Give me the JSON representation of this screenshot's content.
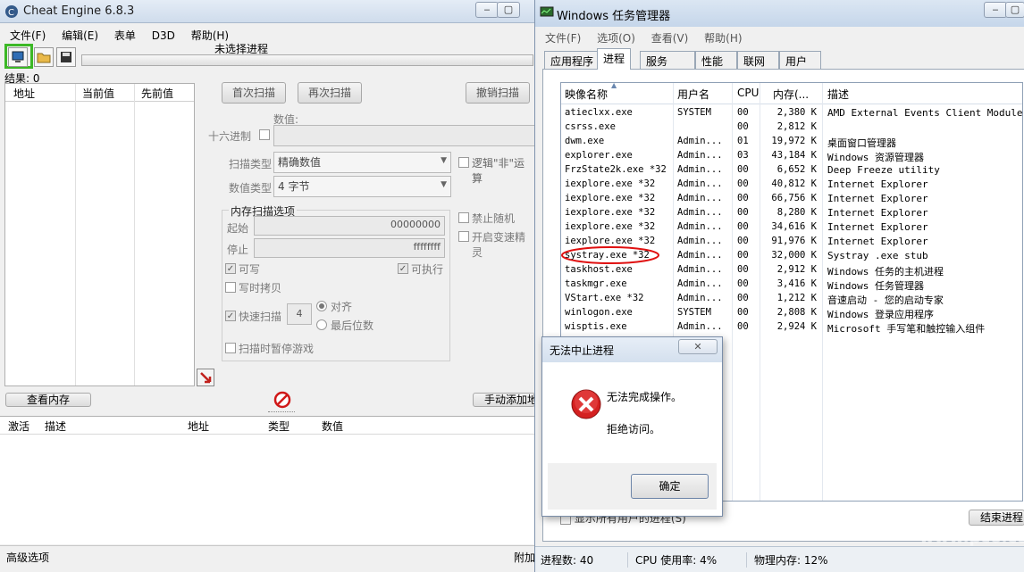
{
  "cheat_engine": {
    "title": "Cheat Engine 6.8.3",
    "window_buttons": {
      "minimize": "▭",
      "maximize": "□"
    },
    "menu": [
      "文件(F)",
      "编辑(E)",
      "表单",
      "D3D",
      "帮助(H)"
    ],
    "process_label": "未选择进程",
    "results_label": "结果: 0",
    "result_columns": [
      "地址",
      "当前值",
      "先前值"
    ],
    "buttons": {
      "first_scan": "首次扫描",
      "next_scan": "再次扫描",
      "undo_scan": "撤销扫描",
      "view_memory": "查看内存",
      "add_address_manually": "手动添加地"
    },
    "value_label": "数值:",
    "hex_label": "十六进制",
    "scan_type_label": "扫描类型",
    "scan_type_value": "精确数值",
    "value_type_label": "数值类型",
    "value_type_value": "4 字节",
    "logical_not_label": "逻辑\"非\"运算",
    "memory_options_title": "内存扫描选项",
    "start_label": "起始",
    "start_value": "00000000",
    "stop_label": "停止",
    "stop_value": "ffffffff",
    "writable_label": "可写",
    "executable_label": "可执行",
    "copy_on_write_label": "写时拷贝",
    "fast_scan_label": "快速扫描",
    "fast_scan_value": "4",
    "align_label": "对齐",
    "last_digits_label": "最后位数",
    "pause_game_label": "扫描时暂停游戏",
    "disable_random_label": "禁止随机",
    "speedhack_label": "开启变速精灵",
    "address_columns": [
      "激活",
      "描述",
      "地址",
      "类型",
      "数值"
    ],
    "advanced_options": "高级选项",
    "attach_label": "附加"
  },
  "task_manager": {
    "title": "Windows 任务管理器",
    "menu": [
      "文件(F)",
      "选项(O)",
      "查看(V)",
      "帮助(H)"
    ],
    "tabs": [
      "应用程序",
      "进程",
      "服务",
      "性能",
      "联网",
      "用户"
    ],
    "active_tab": "进程",
    "columns": [
      "映像名称",
      "用户名",
      "CPU",
      "内存(...",
      "描述"
    ],
    "processes": [
      {
        "name": "atieclxx.exe",
        "user": "SYSTEM",
        "cpu": "00",
        "mem": "2,380 K",
        "desc": "AMD External Events Client Module"
      },
      {
        "name": "csrss.exe",
        "user": "",
        "cpu": "00",
        "mem": "2,812 K",
        "desc": ""
      },
      {
        "name": "dwm.exe",
        "user": "Admin...",
        "cpu": "01",
        "mem": "19,972 K",
        "desc": "桌面窗口管理器"
      },
      {
        "name": "explorer.exe",
        "user": "Admin...",
        "cpu": "03",
        "mem": "43,184 K",
        "desc": "Windows 资源管理器"
      },
      {
        "name": "FrzState2k.exe *32",
        "user": "Admin...",
        "cpu": "00",
        "mem": "6,652 K",
        "desc": "Deep Freeze utility"
      },
      {
        "name": "iexplore.exe *32",
        "user": "Admin...",
        "cpu": "00",
        "mem": "40,812 K",
        "desc": "Internet Explorer"
      },
      {
        "name": "iexplore.exe *32",
        "user": "Admin...",
        "cpu": "00",
        "mem": "66,756 K",
        "desc": "Internet Explorer"
      },
      {
        "name": "iexplore.exe *32",
        "user": "Admin...",
        "cpu": "00",
        "mem": "8,280 K",
        "desc": "Internet Explorer"
      },
      {
        "name": "iexplore.exe *32",
        "user": "Admin...",
        "cpu": "00",
        "mem": "34,616 K",
        "desc": "Internet Explorer"
      },
      {
        "name": "iexplore.exe *32",
        "user": "Admin...",
        "cpu": "00",
        "mem": "91,976 K",
        "desc": "Internet Explorer"
      },
      {
        "name": "systray.exe *32",
        "user": "Admin...",
        "cpu": "00",
        "mem": "32,000 K",
        "desc": "Systray .exe stub"
      },
      {
        "name": "taskhost.exe",
        "user": "Admin...",
        "cpu": "00",
        "mem": "2,912 K",
        "desc": "Windows 任务的主机进程"
      },
      {
        "name": "taskmgr.exe",
        "user": "Admin...",
        "cpu": "00",
        "mem": "3,416 K",
        "desc": "Windows 任务管理器"
      },
      {
        "name": "VStart.exe *32",
        "user": "Admin...",
        "cpu": "00",
        "mem": "1,212 K",
        "desc": "音速启动 - 您的启动专家"
      },
      {
        "name": "winlogon.exe",
        "user": "SYSTEM",
        "cpu": "00",
        "mem": "2,808 K",
        "desc": "Windows 登录应用程序"
      },
      {
        "name": "wisptis.exe",
        "user": "Admin...",
        "cpu": "00",
        "mem": "2,924 K",
        "desc": "Microsoft 手写笔和触控输入组件"
      }
    ],
    "show_all_label": "显示所有用户的进程(S)",
    "end_process": "结束进程",
    "status": {
      "processes": "进程数: 40",
      "cpu": "CPU 使用率: 4%",
      "memory": "物理内存: 12%"
    },
    "highlight_color": "#e01010"
  },
  "dialog": {
    "title": "无法中止进程",
    "message": "无法完成操作。",
    "detail": "拒绝访问。",
    "ok": "确定",
    "close_glyph": "✕"
  },
  "watermark": "www.pc6.com"
}
